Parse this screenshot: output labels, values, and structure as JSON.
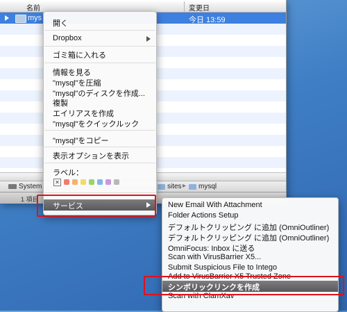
{
  "finder": {
    "col_name": "名前",
    "col_modified": "変更日",
    "selected_row": {
      "name": "mys",
      "modified": "今日 13:59"
    },
    "path": [
      {
        "icon": "disk-icon",
        "label": "System"
      },
      {
        "icon": "folder-icon",
        "label": "sites"
      },
      {
        "icon": "folder-icon",
        "label": "mysql"
      }
    ],
    "status": "1 項目"
  },
  "context_menu": {
    "items": [
      "開く",
      "Dropbox",
      "ゴミ箱に入れる",
      "情報を見る",
      "\"mysql\"を圧縮",
      "\"mysql\"のディスクを作成...",
      "複製",
      "エイリアスを作成",
      "\"mysql\"をクイックルック",
      "\"mysql\"をコピー",
      "表示オプションを表示",
      "ラベル：",
      "サービス"
    ],
    "label_colors": [
      "#f07b6d",
      "#f5b26c",
      "#f1dc6a",
      "#9ad36e",
      "#82b6ec",
      "#c899e0",
      "#b8b8b8"
    ]
  },
  "services_menu": {
    "items": [
      "New Email With Attachment",
      "Folder Actions Setup",
      "デフォルトクリッピング に追加 (OmniOutliner)",
      "デフォルトクリッピング に追加 (OmniOutliner)",
      "OmniFocus: Inbox に送る",
      "Scan with VirusBarrier X5...",
      "Submit Suspicious File to Intego",
      "Add to VirusBarrier X5 Trusted Zone",
      "シンボリックリンクを作成",
      "Scan with ClamXav"
    ]
  },
  "colors": {
    "highlight": "#5f5f63",
    "selection": "#3d80df",
    "annotation": "#e0111b"
  }
}
